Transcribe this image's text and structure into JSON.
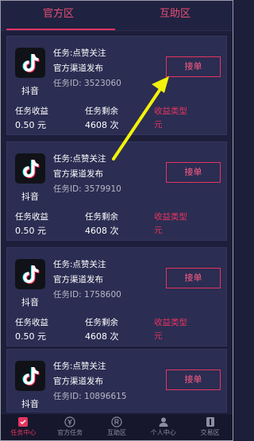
{
  "tabs": [
    {
      "label": "官方区",
      "active": true
    },
    {
      "label": "互助区",
      "active": false
    }
  ],
  "tasks": [
    {
      "app_name": "抖音",
      "task": "任务:点赞关注",
      "source": "官方渠道发布",
      "task_id": "任务ID:  3523060",
      "accept": "接单",
      "income_label": "任务收益",
      "income_value": "0.50 元",
      "remaining_label": "任务剩余",
      "remaining_value": "4608 次",
      "type_label": "收益类型",
      "type_value": "元"
    },
    {
      "app_name": "抖音",
      "task": "任务:点赞关注",
      "source": "官方渠道发布",
      "task_id": "任务ID:  3579910",
      "accept": "接单",
      "income_label": "任务收益",
      "income_value": "0.50 元",
      "remaining_label": "任务剩余",
      "remaining_value": "4608 次",
      "type_label": "收益类型",
      "type_value": "元"
    },
    {
      "app_name": "抖音",
      "task": "任务:点赞关注",
      "source": "官方渠道发布",
      "task_id": "任务ID:  1758600",
      "accept": "接单",
      "income_label": "任务收益",
      "income_value": "0.50 元",
      "remaining_label": "任务剩余",
      "remaining_value": "4608 次",
      "type_label": "收益类型",
      "type_value": "元"
    },
    {
      "app_name": "抖音",
      "task": "任务:点赞关注",
      "source": "官方渠道发布",
      "task_id": "任务ID:  10896615",
      "accept": "接单"
    }
  ],
  "nav": [
    {
      "label": "任务中心",
      "icon": "task-center-icon",
      "active": true
    },
    {
      "label": "官方任务",
      "icon": "yen-icon",
      "active": false
    },
    {
      "label": "互助区",
      "icon": "registered-icon",
      "active": false
    },
    {
      "label": "个人中心",
      "icon": "person-icon",
      "active": false
    },
    {
      "label": "交易区",
      "icon": "trade-icon",
      "active": false
    }
  ],
  "colors": {
    "accent": "#e43560",
    "background": "#1d1e3a",
    "card": "#2b2d52",
    "annotation_arrow": "#f2f20a"
  }
}
